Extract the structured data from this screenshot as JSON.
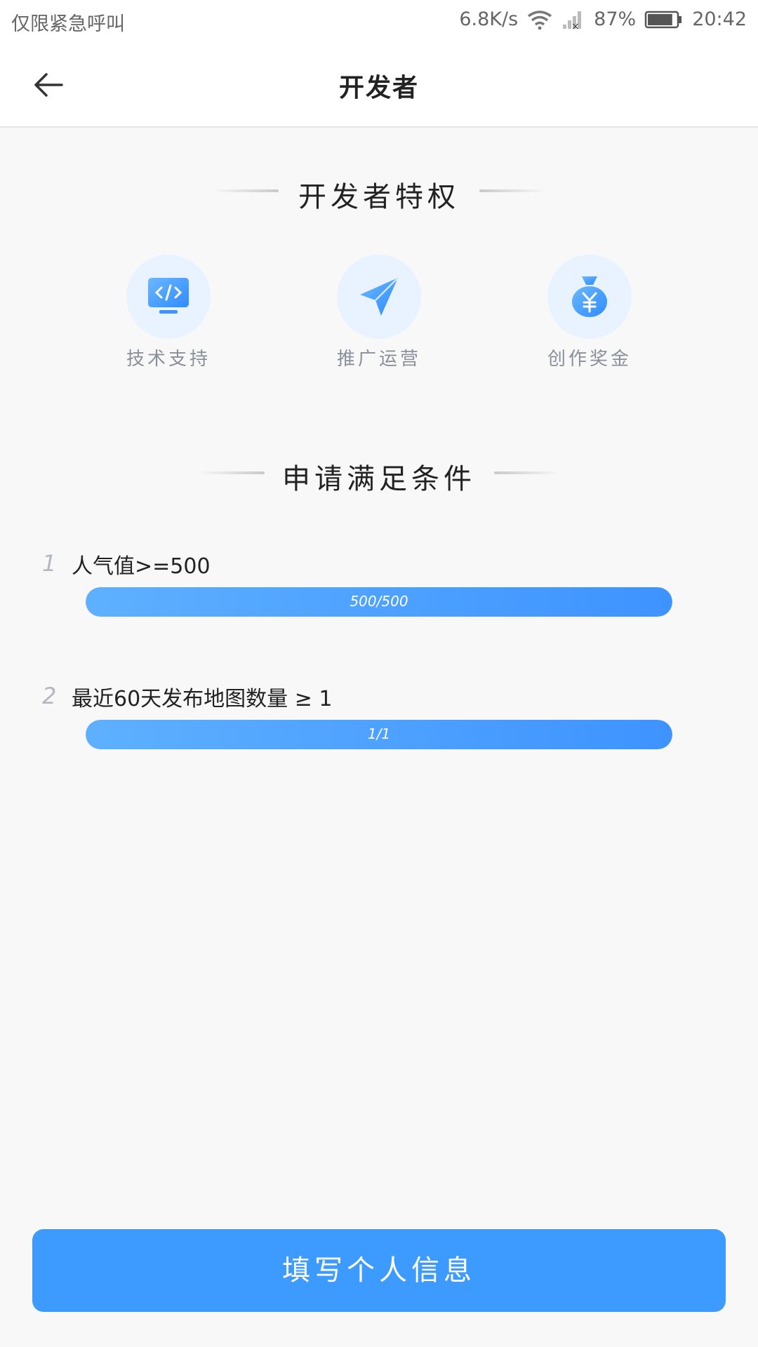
{
  "status_bar": {
    "carrier_text": "仅限紧急呼叫",
    "net_speed": "6.8K/s",
    "battery_percent": "87%",
    "time": "20:42",
    "battery_level": 0.87
  },
  "header": {
    "title": "开发者",
    "back_icon": "arrow-left-icon"
  },
  "privileges": {
    "title": "开发者特权",
    "items": [
      {
        "label": "技术支持",
        "icon": "code-monitor-icon"
      },
      {
        "label": "推广运营",
        "icon": "paper-plane-icon"
      },
      {
        "label": "创作奖金",
        "icon": "money-bag-icon"
      }
    ]
  },
  "conditions": {
    "title": "申请满足条件",
    "items": [
      {
        "number": "1",
        "text": "人气值>=500",
        "progress_text": "500/500",
        "progress": 1.0
      },
      {
        "number": "2",
        "text": "最近60天发布地图数量 ≥ 1",
        "progress_text": "1/1",
        "progress": 1.0
      }
    ]
  },
  "submit_button": {
    "label": "填写个人信息"
  },
  "colors": {
    "accent": "#3d9bff",
    "icon_bg": "#e8f3ff",
    "bar_start": "#5eb0ff",
    "bar_end": "#3e93ff"
  }
}
